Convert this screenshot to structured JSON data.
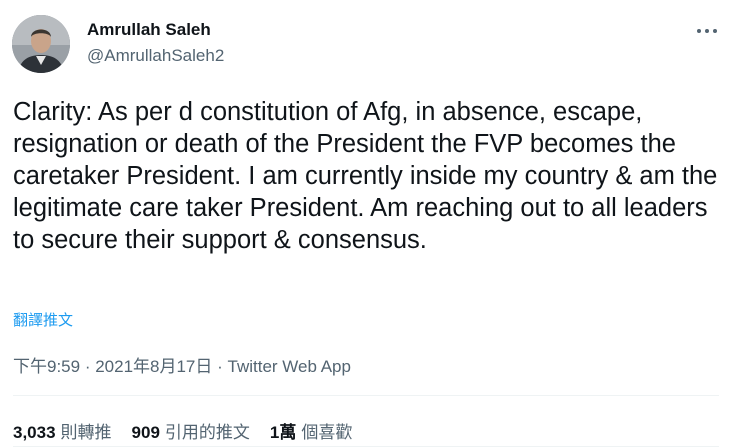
{
  "author": {
    "name": "Amrullah Saleh",
    "handle": "@AmrullahSaleh2"
  },
  "tweet": {
    "text": "Clarity: As per d constitution of Afg, in absence, escape, resignation or death of the President the FVP becomes the caretaker President. I am currently inside my country & am the legitimate care taker President. Am reaching out to all leaders to secure their support & consensus.",
    "translate_label": "翻譯推文"
  },
  "meta": {
    "time": "下午9:59",
    "separator1": " · ",
    "date": "2021年8月17日",
    "separator2": " · ",
    "source": "Twitter Web App"
  },
  "stats": {
    "retweets_count": "3,033",
    "retweets_label": "則轉推",
    "quotes_count": "909",
    "quotes_label": "引用的推文",
    "likes_count": "1萬",
    "likes_label": "個喜歡"
  },
  "icons": {
    "avatar": "profile-photo",
    "more": "more-horizontal-icon"
  },
  "colors": {
    "text_primary": "#0f1419",
    "text_secondary": "#536471",
    "link": "#1d9bf0",
    "divider": "#eff3f4"
  }
}
